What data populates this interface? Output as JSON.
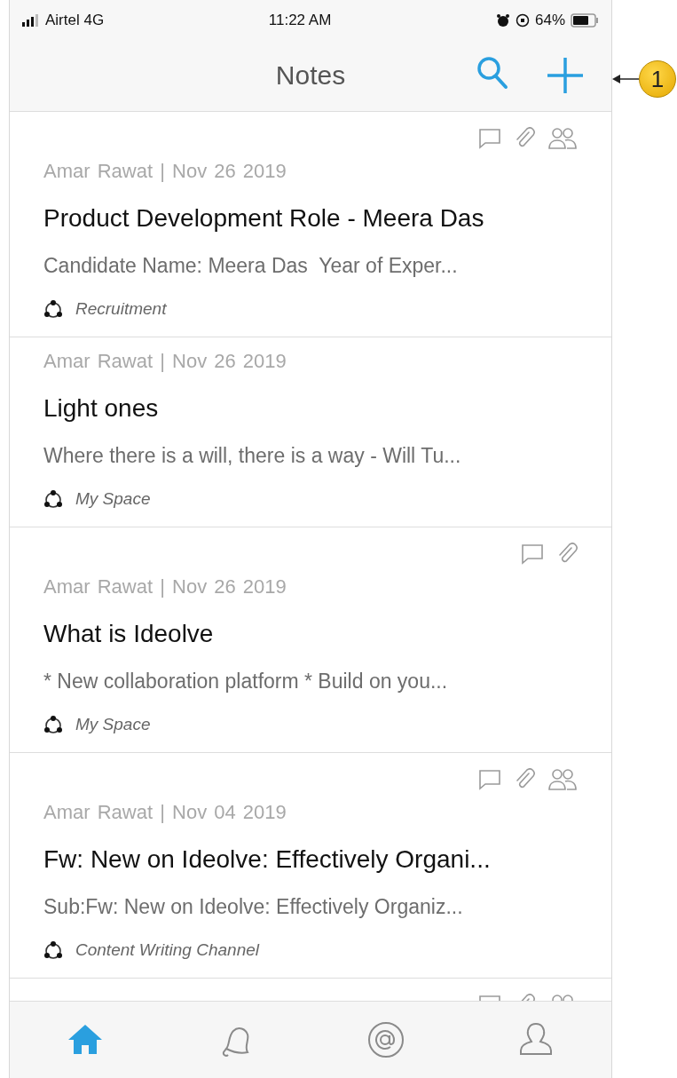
{
  "status_bar": {
    "carrier": "Airtel 4G",
    "time": "11:22 AM",
    "battery": "64%"
  },
  "nav": {
    "title": "Notes"
  },
  "callout": {
    "label": "1"
  },
  "notes": [
    {
      "author": "Amar Rawat",
      "separator": "|",
      "date": "Nov 26 2019",
      "title": "Product Development Role - Meera Das",
      "preview": "Candidate Name: Meera Das  Year of Exper...",
      "space": "Recruitment",
      "comment": true,
      "attachment": true,
      "shared": true
    },
    {
      "author": "Amar Rawat",
      "separator": "|",
      "date": "Nov 26 2019",
      "title": "Light ones",
      "preview": "Where there is a will, there is a way - Will Tu...",
      "space": "My Space",
      "comment": false,
      "attachment": false,
      "shared": false
    },
    {
      "author": "Amar Rawat",
      "separator": "|",
      "date": "Nov 26 2019",
      "title": "What is Ideolve",
      "preview": "* New collaboration platform * Build on you...",
      "space": "My Space",
      "comment": true,
      "attachment": true,
      "shared": false
    },
    {
      "author": "Amar Rawat",
      "separator": "|",
      "date": "Nov 04 2019",
      "title": "Fw: New on Ideolve: Effectively Organi...",
      "preview": "Sub:Fw: New on Ideolve: Effectively Organiz...",
      "space": "Content Writing Channel",
      "comment": true,
      "attachment": true,
      "shared": true
    },
    {
      "comment": true,
      "attachment": true,
      "shared": true
    }
  ],
  "tabs": [
    {
      "kind": "home",
      "selected": true
    },
    {
      "kind": "notifications",
      "selected": false
    },
    {
      "kind": "mentions",
      "selected": false
    },
    {
      "kind": "profile",
      "selected": false
    }
  ]
}
